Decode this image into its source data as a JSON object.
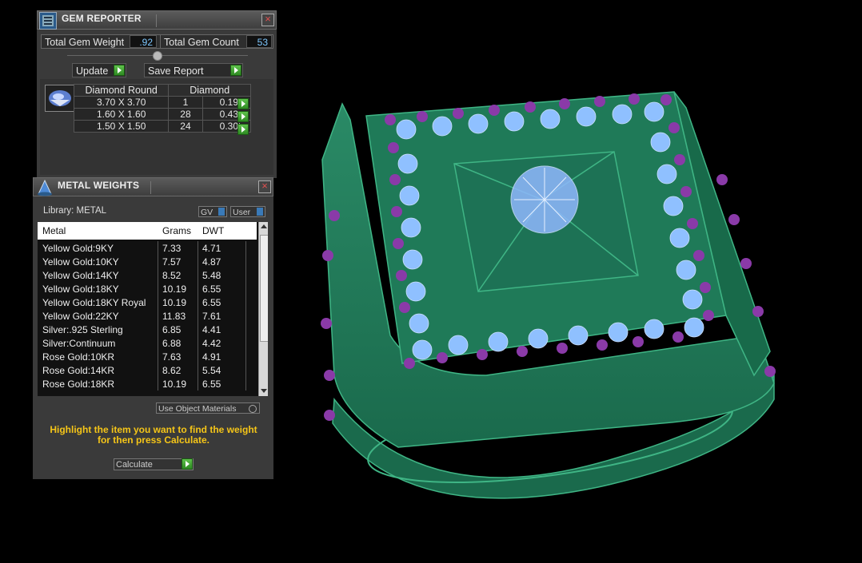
{
  "gem_reporter": {
    "title": "GEM REPORTER",
    "close": "×",
    "total_weight_label": "Total Gem Weight",
    "total_weight_value": ".92",
    "total_count_label": "Total Gem Count",
    "total_count_value": "53",
    "update_label": "Update",
    "save_report_label": "Save Report",
    "table": {
      "col_shape": "Diamond Round",
      "col_material": "Diamond",
      "rows": [
        {
          "size": "3.70 X 3.70",
          "count": "1",
          "weight": "0.19tw"
        },
        {
          "size": "1.60 X 1.60",
          "count": "28",
          "weight": "0.43tw"
        },
        {
          "size": "1.50 X 1.50",
          "count": "24",
          "weight": "0.30tw"
        }
      ]
    }
  },
  "metal_weights": {
    "title": "METAL WEIGHTS",
    "close": "×",
    "library_label": "Library: METAL",
    "gv_label": "GV",
    "user_label": "User",
    "columns": [
      "Metal",
      "Grams",
      "DWT"
    ],
    "rows": [
      {
        "metal": "Yellow Gold:9KY",
        "grams": "7.33",
        "dwt": "4.71"
      },
      {
        "metal": "Yellow Gold:10KY",
        "grams": "7.57",
        "dwt": "4.87"
      },
      {
        "metal": "Yellow Gold:14KY",
        "grams": "8.52",
        "dwt": "5.48"
      },
      {
        "metal": "Yellow Gold:18KY",
        "grams": "10.19",
        "dwt": "6.55"
      },
      {
        "metal": "Yellow Gold:18KY Royal",
        "grams": "10.19",
        "dwt": "6.55"
      },
      {
        "metal": "Yellow Gold:22KY",
        "grams": "11.83",
        "dwt": "7.61"
      },
      {
        "metal": "Silver:.925 Sterling",
        "grams": "6.85",
        "dwt": "4.41"
      },
      {
        "metal": "Silver:Continuum",
        "grams": "6.88",
        "dwt": "4.42"
      },
      {
        "metal": "Rose Gold:10KR",
        "grams": "7.63",
        "dwt": "4.91"
      },
      {
        "metal": "Rose Gold:14KR",
        "grams": "8.62",
        "dwt": "5.54"
      },
      {
        "metal": "Rose Gold:18KR",
        "grams": "10.19",
        "dwt": "6.55"
      }
    ],
    "use_object_materials_label": "Use Object Materials",
    "hint_line1": "Highlight the item you want to find the weight",
    "hint_line2": "for then press Calculate.",
    "calculate_label": "Calculate"
  },
  "colors": {
    "ring_metal": "#1f7a58",
    "gem_light": "#8fc0ff",
    "gem_prong": "#8a3aa8"
  }
}
